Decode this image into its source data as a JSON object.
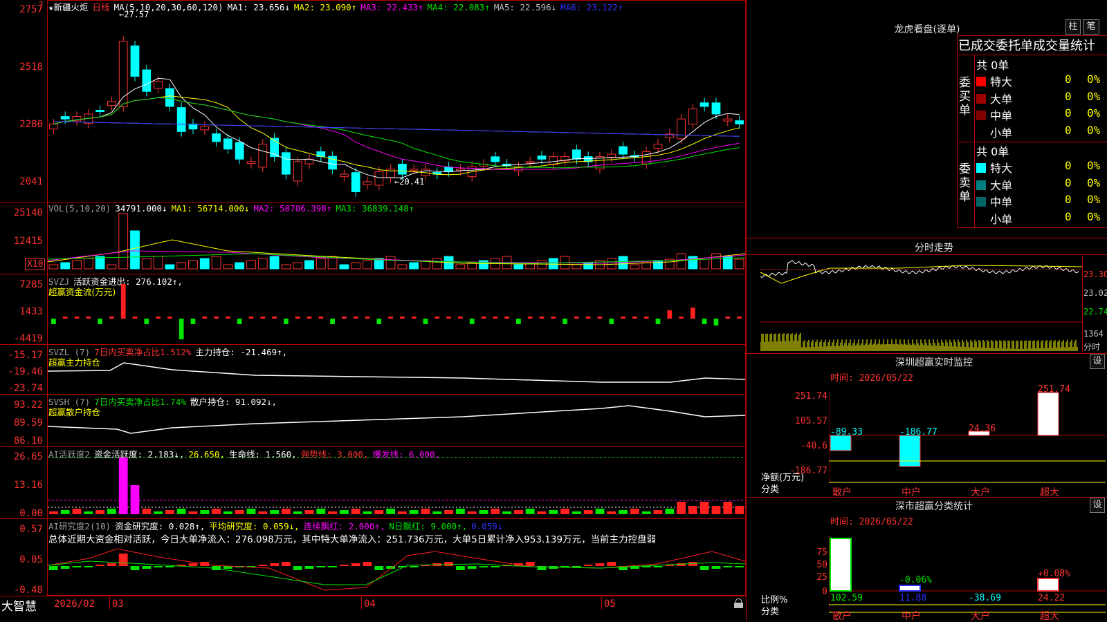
{
  "main_chart": {
    "star": "★",
    "name": "新疆火炬",
    "period": "日线",
    "ma_header": "MA(5,10,20,30,60,120)",
    "ma_values": [
      {
        "label": "MA1:",
        "value": "23.656↓",
        "color": "#ffffff"
      },
      {
        "label": "MA2:",
        "value": "23.090↑",
        "color": "#ffff00"
      },
      {
        "label": "MA3:",
        "value": "22.433↑",
        "color": "#ff00ff"
      },
      {
        "label": "MA4:",
        "value": "22.083↑",
        "color": "#00e600"
      },
      {
        "label": "MA5:",
        "value": "22.596↓",
        "color": "#c0c0c0"
      },
      {
        "label": "MA6:",
        "value": "23.122↑",
        "color": "#3232ff"
      }
    ],
    "y_ticks": [
      "2757",
      "2518",
      "2280",
      "2041"
    ],
    "high_label": "←27.57",
    "low_label": "←20.41"
  },
  "vol_panel": {
    "header": "VOL(5,10,20)",
    "values": [
      {
        "label": "",
        "value": "34791.000↓",
        "color": "#ffffff"
      },
      {
        "label": "MA1:",
        "value": "56714.000↓",
        "color": "#ffff00"
      },
      {
        "label": "MA2:",
        "value": "50706.398↑",
        "color": "#ff00ff"
      },
      {
        "label": "MA3:",
        "value": "36839.148↑",
        "color": "#00e600"
      }
    ],
    "y_ticks": [
      "25140",
      "12415"
    ],
    "scale_label": "X10"
  },
  "svzj_panel": {
    "header": "SVZJ",
    "label1": "活跃资金进出: 276.102↑,",
    "label2": "超赢资金流(万元)",
    "y_ticks": [
      "7285",
      "1433",
      "-4419"
    ]
  },
  "svzl_panel": {
    "header": "SVZL (7)",
    "label1": "7日内买卖净占比1.512%",
    "label2": "主力持仓: -21.469↑,",
    "label3": "超赢主力持仓",
    "y_ticks": [
      "-15.17",
      "-19.46",
      "-23.74"
    ]
  },
  "svsh_panel": {
    "header": "SVSH (7)",
    "label1": "7日内买卖净占比1.74%",
    "label2": "散户持仓: 91.092↓,",
    "label3": "超赢散户持仓",
    "y_ticks": [
      "93.22",
      "89.59",
      "86.10"
    ]
  },
  "ai_active_panel": {
    "header": "AI活跃度2",
    "values": [
      {
        "label": "资金活跃度:",
        "value": "2.183↓,",
        "color": "#ffffff"
      },
      {
        "label": "",
        "value": "26.650,",
        "color": "#ffff00"
      },
      {
        "label": "生命线:",
        "value": "1.560,",
        "color": "#ffffff"
      },
      {
        "label": "强势线:",
        "value": "3.000,",
        "color": "#ff3232"
      },
      {
        "label": "爆发线:",
        "value": "6.000,",
        "color": "#ff00ff"
      }
    ],
    "y_ticks": [
      "26.65",
      "13.16",
      "0.00"
    ]
  },
  "ai_research_panel": {
    "header": "AI研究度2(10)",
    "values": [
      {
        "label": "资金研究度:",
        "value": "0.028↑,",
        "color": "#ffffff"
      },
      {
        "label": "平均研究度:",
        "value": "0.059↓,",
        "color": "#ffff00"
      },
      {
        "label": "连续飘红:",
        "value": "2.000↑,",
        "color": "#ff00ff"
      },
      {
        "label": "N日飘红:",
        "value": "9.000↑,",
        "color": "#00e600"
      },
      {
        "label": "",
        "value": "0.059↓",
        "color": "#3232ff"
      }
    ],
    "summary": "总体近期大资金相对活跃，今日大单净流入：276.098万元，其中特大单净流入：251.736万元，大单5日累计净入953.139万元，当前主力控盘弱",
    "y_ticks": [
      "0.57",
      "0.05",
      "-0.48"
    ]
  },
  "bottom_bar": {
    "brand": "大智慧",
    "dates": [
      "2026/02",
      "03",
      "04",
      "05"
    ]
  },
  "right_panel": {
    "dragon_title": "龙虎看盘(逐单)",
    "btn_col": "柱",
    "btn_pen": "笔",
    "stats_title": "已成交委托单成交量统计",
    "buy_label": "委买单",
    "sell_label": "委卖单",
    "buy_total": "共 0单",
    "sell_total": "共 0单",
    "buy_rows": [
      {
        "name": "特大",
        "count": "0",
        "pct": "0%",
        "color": "#ff0000"
      },
      {
        "name": "大单",
        "count": "0",
        "pct": "0%",
        "color": "#a00000"
      },
      {
        "name": "中单",
        "count": "0",
        "pct": "0%",
        "color": "#800000"
      },
      {
        "name": "小单",
        "count": "0",
        "pct": "0%",
        "color": "#000000"
      }
    ],
    "sell_rows": [
      {
        "name": "特大",
        "count": "0",
        "pct": "0%",
        "color": "#00ffff"
      },
      {
        "name": "大单",
        "count": "0",
        "pct": "0%",
        "color": "#008080"
      },
      {
        "name": "中单",
        "count": "0",
        "pct": "0%",
        "color": "#006666"
      },
      {
        "name": "小单",
        "count": "0",
        "pct": "0%",
        "color": "#000000"
      }
    ],
    "intraday_title": "分时走势",
    "intraday_ticks": [
      "23.30",
      "23.02",
      "22.74"
    ],
    "intraday_vol_tick": "1364",
    "intraday_vol_unit": "分时",
    "sz_monitor_title": "深圳超赢实时监控",
    "sz_btn": "设",
    "sz_time": "时间: 2026/05/22",
    "sz_ticks": [
      "251.74",
      "105.57",
      "-40.6",
      "-186.77"
    ],
    "sz_axis_label1": "净额(万元)",
    "sz_axis_label2": "分类",
    "sz_bar_labels": [
      "-89.33",
      "-186.77",
      "24.36",
      "251.74"
    ],
    "sz_categories": [
      "散户",
      "中户",
      "大户",
      "超大"
    ],
    "class_title": "深市超赢分类统计",
    "class_btn": "设",
    "class_time": "时间: 2026/05/22",
    "class_ticks": [
      "75",
      "50",
      "25",
      "0"
    ],
    "class_axis_label1": "比例%",
    "class_axis_label2": "分类",
    "class_bar_labels": [
      "",
      "-0.06%",
      "",
      "+0.08%"
    ],
    "class_values": [
      "102.59",
      "11.88",
      "-38.69",
      "24.22"
    ],
    "class_categories": [
      "散户",
      "中户",
      "大户",
      "超大"
    ]
  }
}
